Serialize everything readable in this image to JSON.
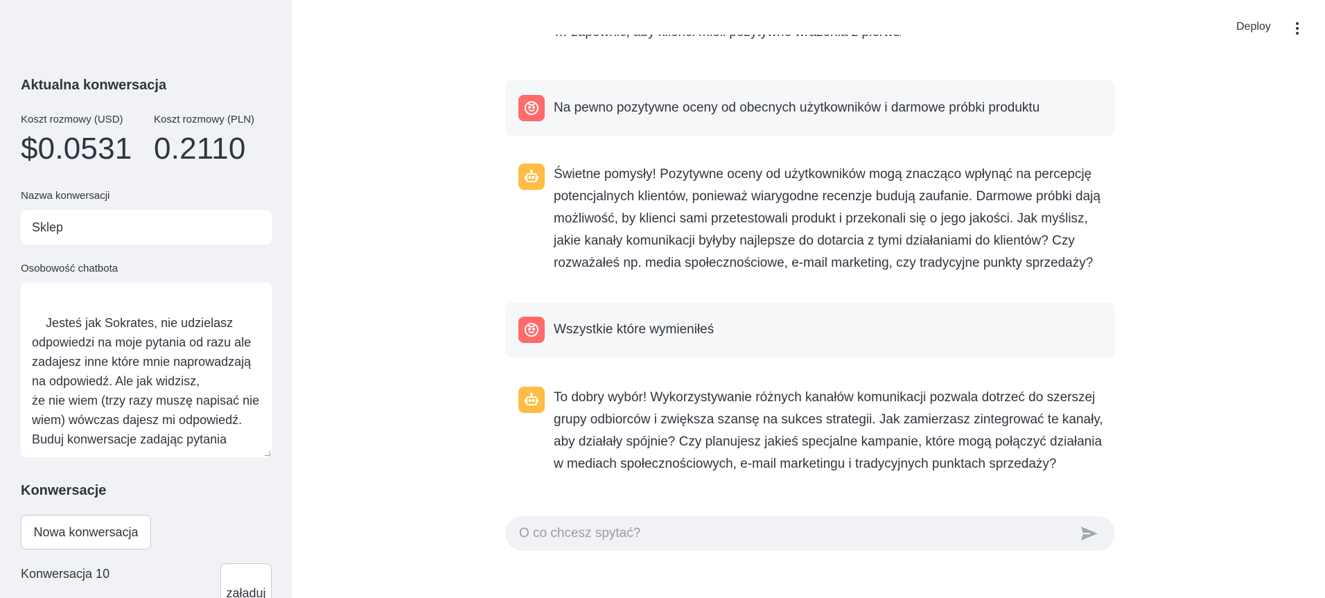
{
  "sidebar": {
    "current_heading": "Aktualna konwersacja",
    "metric_usd_label": "Koszt rozmowy (USD)",
    "metric_usd_value": "$0.0531",
    "metric_pln_label": "Koszt rozmowy (PLN)",
    "metric_pln_value": "0.2110",
    "name_label": "Nazwa konwersacji",
    "name_value": "Sklep",
    "personality_label": "Osobowość chatbota",
    "personality_value": "Jesteś jak Sokrates, nie udzielasz odpowiedzi na moje pytania od razu ale zadajesz inne które mnie naprowadzają na odpowiedź. Ale jak widzisz,\nże nie wiem (trzy razy muszę napisać nie wiem) wówczas dajesz mi odpowiedź.\nBuduj konwersacje zadając pytania",
    "conversations_heading": "Konwersacje",
    "new_button": "Nowa konwersacja",
    "conversation_item": "Konwersacja 10",
    "load_button": "załaduj"
  },
  "header": {
    "deploy": "Deploy",
    "menu_icon": "kebab-menu-icon"
  },
  "chat": {
    "cut_text": "… zapewnić, aby klienci mieli pozytywne wrażenia z pierwszego kontaktu z Twoim produktem?",
    "messages": [
      {
        "role": "user",
        "icon": "user-face-icon",
        "text": "Na pewno pozytywne oceny od obecnych użytkowników i darmowe próbki produktu"
      },
      {
        "role": "assistant",
        "icon": "robot-icon",
        "text": "Świetne pomysły! Pozytywne oceny od użytkowników mogą znacząco wpłynąć na percepcję potencjalnych klientów, ponieważ wiarygodne recenzje budują zaufanie. Darmowe próbki dają możliwość, by klienci sami przetestowali produkt i przekonali się o jego jakości. Jak myślisz, jakie kanały komunikacji byłyby najlepsze do dotarcia z tymi działaniami do klientów? Czy rozważałeś np. media społecznościowe, e-mail marketing, czy tradycyjne punkty sprzedaży?"
      },
      {
        "role": "user",
        "icon": "user-face-icon",
        "text": "Wszystkie które wymieniłeś"
      },
      {
        "role": "assistant",
        "icon": "robot-icon",
        "text": "To dobry wybór! Wykorzystywanie różnych kanałów komunikacji pozwala dotrzeć do szerszej grupy odbiorców i zwiększa szansę na sukces strategii. Jak zamierzasz zintegrować te kanały, aby działały spójnie? Czy planujesz jakieś specjalne kampanie, które mogą połączyć działania w mediach społecznościowych, e-mail marketingu i tradycyjnych punktach sprzedaży?"
      }
    ],
    "input_placeholder": "O co chcesz spytać?",
    "send_icon": "send-icon"
  },
  "colors": {
    "sidebar_bg": "#f0f2f6",
    "user_avatar": "#ff6b6b",
    "bot_avatar": "#ffbd45",
    "user_message_bg": "#f6f7f9"
  }
}
